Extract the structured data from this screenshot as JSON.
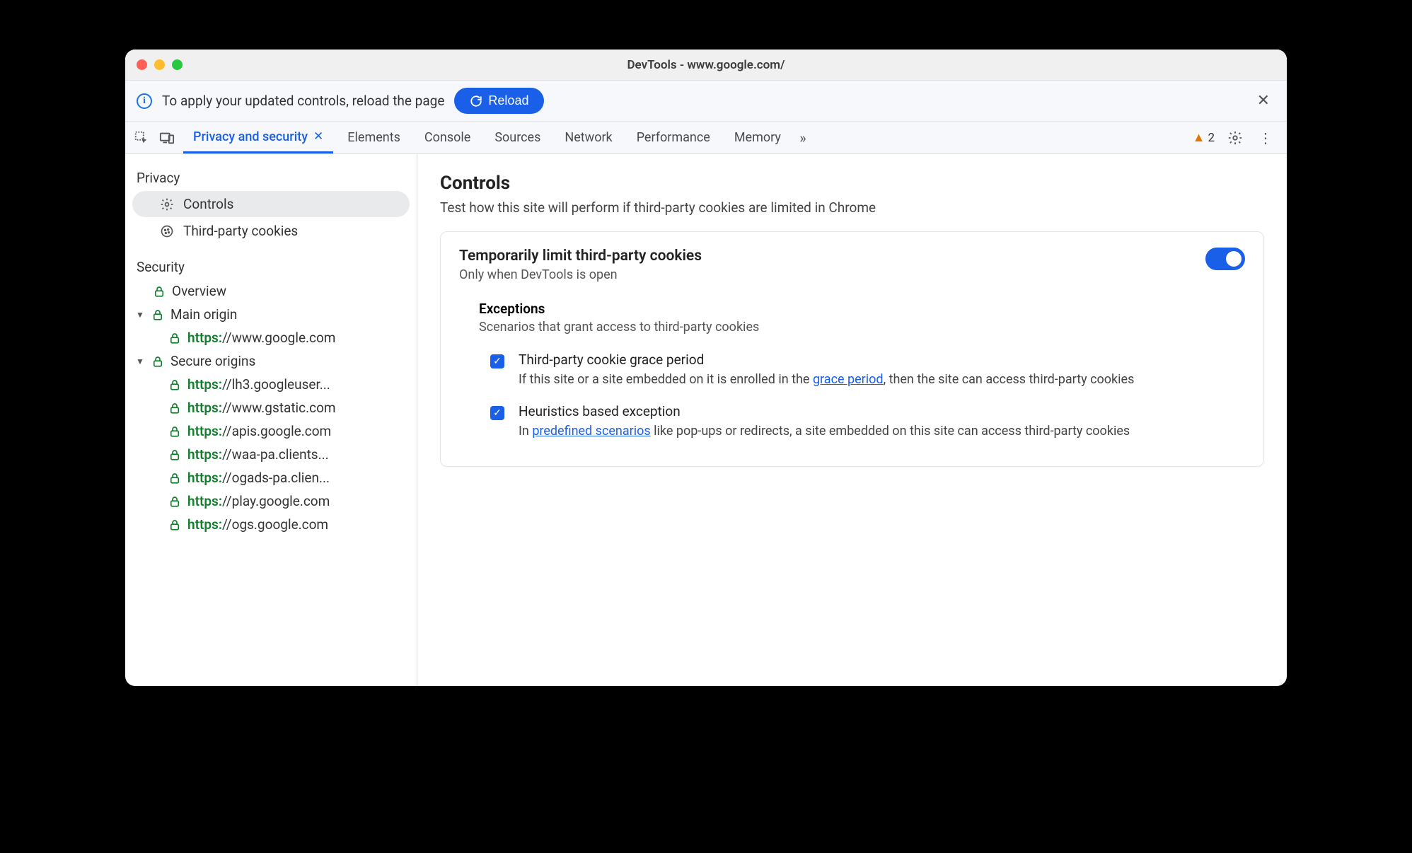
{
  "window": {
    "title": "DevTools - www.google.com/"
  },
  "infobar": {
    "message": "To apply your updated controls, reload the page",
    "reload_label": "Reload"
  },
  "tabs": {
    "active": "Privacy and security",
    "items": [
      "Elements",
      "Console",
      "Sources",
      "Network",
      "Performance",
      "Memory"
    ],
    "warning_count": "2"
  },
  "sidebar": {
    "privacy_header": "Privacy",
    "privacy_items": [
      {
        "label": "Controls",
        "icon": "gear",
        "selected": true
      },
      {
        "label": "Third-party cookies",
        "icon": "cookie",
        "selected": false
      }
    ],
    "security_header": "Security",
    "tree": {
      "overview_label": "Overview",
      "main_origin_label": "Main origin",
      "main_origin": {
        "proto": "https:",
        "rest": "//www.google.com"
      },
      "secure_label": "Secure origins",
      "secure_origins": [
        {
          "proto": "https:",
          "rest": "//lh3.googleuser..."
        },
        {
          "proto": "https:",
          "rest": "//www.gstatic.com"
        },
        {
          "proto": "https:",
          "rest": "//apis.google.com"
        },
        {
          "proto": "https:",
          "rest": "//waa-pa.clients..."
        },
        {
          "proto": "https:",
          "rest": "//ogads-pa.clien..."
        },
        {
          "proto": "https:",
          "rest": "//play.google.com"
        },
        {
          "proto": "https:",
          "rest": "//ogs.google.com"
        }
      ]
    }
  },
  "content": {
    "heading": "Controls",
    "subtitle": "Test how this site will perform if third-party cookies are limited in Chrome",
    "card": {
      "title": "Temporarily limit third-party cookies",
      "subtitle": "Only when DevTools is open",
      "exceptions_header": "Exceptions",
      "exceptions_sub": "Scenarios that grant access to third-party cookies",
      "items": [
        {
          "label": "Third-party cookie grace period",
          "desc_before": "If this site or a site embedded on it is enrolled in the ",
          "link": "grace period",
          "desc_after": ", then the site can access third-party cookies"
        },
        {
          "label": "Heuristics based exception",
          "desc_before": "In ",
          "link": "predefined scenarios",
          "desc_after": " like pop-ups or redirects, a site embedded on this site can access third-party cookies"
        }
      ]
    }
  }
}
